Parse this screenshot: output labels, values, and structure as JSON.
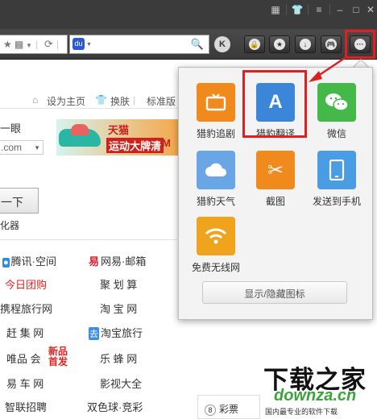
{
  "titlebar": {
    "icons": [
      "grid-icon",
      "shirt-icon",
      "menu-icon",
      "minimize-icon",
      "maximize-icon",
      "close-icon"
    ]
  },
  "toolbar": {
    "buttons": [
      "k-icon",
      "lock-icon",
      "star-icon",
      "download-icon",
      "gamepad-icon",
      "more-icon"
    ]
  },
  "page": {
    "topbar": {
      "home": "设为主页",
      "skin": "换肤",
      "standard": "标准版"
    },
    "frag1": "一眼",
    "combo": ".com",
    "ad": {
      "brand": "天猫 TMALL.COM",
      "slogan": "运动大牌清"
    },
    "search_button": "一下",
    "frag2": "化器",
    "links": [
      [
        "腾讯·空间",
        "网易·邮箱"
      ],
      [
        "今日团购",
        "聚 划 算"
      ],
      [
        "携程旅行网",
        "淘 宝 网"
      ],
      [
        "赶 集 网",
        "淘宝旅行"
      ],
      [
        "唯品 会",
        "乐 蜂 网"
      ],
      [
        "易 车 网",
        "影视大全"
      ],
      [
        "智联招聘",
        "双色球·竞彩"
      ]
    ],
    "hot_badge": "新品首发",
    "lottery": "彩票",
    "lottery_num": "8"
  },
  "popup": {
    "apps": [
      {
        "label": "猎豹追剧",
        "icon": "tv-icon",
        "color": "#f08a1c"
      },
      {
        "label": "猎豹翻译",
        "icon": "translate-icon",
        "color": "#3b86d8"
      },
      {
        "label": "微信",
        "icon": "wechat-icon",
        "color": "#45b84a"
      },
      {
        "label": "猎豹天气",
        "icon": "weather-icon",
        "color": "#6aa6e6"
      },
      {
        "label": "截图",
        "icon": "scissors-icon",
        "color": "#f08a1c"
      },
      {
        "label": "发送到手机",
        "icon": "phone-icon",
        "color": "#4a9de2"
      },
      {
        "label": "免费无线网",
        "icon": "wifi-icon",
        "color": "#f0a31c"
      }
    ],
    "translate_letter": "A",
    "toggle_label": "显示/隐藏图标"
  },
  "watermark": {
    "title": "下载之家",
    "domain": "downza.cn",
    "tagline": "国内最专业的软件下载"
  }
}
